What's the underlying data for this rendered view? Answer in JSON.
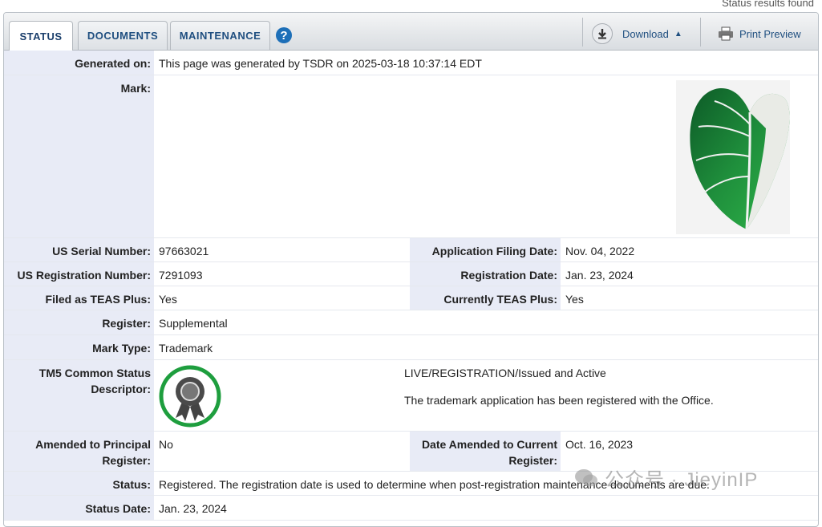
{
  "header_note": "Status results found",
  "tabs": [
    {
      "label": "STATUS",
      "active": true
    },
    {
      "label": "DOCUMENTS",
      "active": false
    },
    {
      "label": "MAINTENANCE",
      "active": false
    }
  ],
  "help_icon": "question-circle-icon",
  "toolbar": {
    "download_label": "Download",
    "print_label": "Print Preview"
  },
  "rows": {
    "generated_on": {
      "label": "Generated on:",
      "value": "This page was generated by TSDR on 2025-03-18 10:37:14 EDT"
    },
    "mark": {
      "label": "Mark:"
    },
    "serial": {
      "label": "US Serial Number:",
      "value": "97663021"
    },
    "filing_date": {
      "label": "Application Filing Date:",
      "value": "Nov. 04, 2022"
    },
    "reg_number": {
      "label": "US Registration Number:",
      "value": "7291093"
    },
    "reg_date": {
      "label": "Registration Date:",
      "value": "Jan. 23, 2024"
    },
    "teas_plus": {
      "label": "Filed as TEAS Plus:",
      "value": "Yes"
    },
    "current_teas": {
      "label": "Currently TEAS Plus:",
      "value": "Yes"
    },
    "register": {
      "label": "Register:",
      "value": "Supplemental"
    },
    "mark_type": {
      "label": "Mark Type:",
      "value": "Trademark"
    },
    "tm5": {
      "label": "TM5 Common Status Descriptor:",
      "status": "LIVE/REGISTRATION/Issued and Active",
      "description": "The trademark application has been registered with the Office."
    },
    "amended_principal": {
      "label": "Amended to Principal Register:",
      "value": "No"
    },
    "date_amended": {
      "label": "Date Amended to Current Register:",
      "value": "Oct. 16, 2023"
    },
    "status": {
      "label": "Status:",
      "value": "Registered. The registration date is used to determine when post-registration maintenance documents are due."
    },
    "status_date": {
      "label": "Status Date:",
      "value": "Jan. 23, 2024"
    }
  },
  "watermark": "公众号 · JieyinIP",
  "colors": {
    "label_bg": "#e8ebf6",
    "tab_text": "#1f4f80",
    "badge_ring": "#1e9e3e"
  }
}
